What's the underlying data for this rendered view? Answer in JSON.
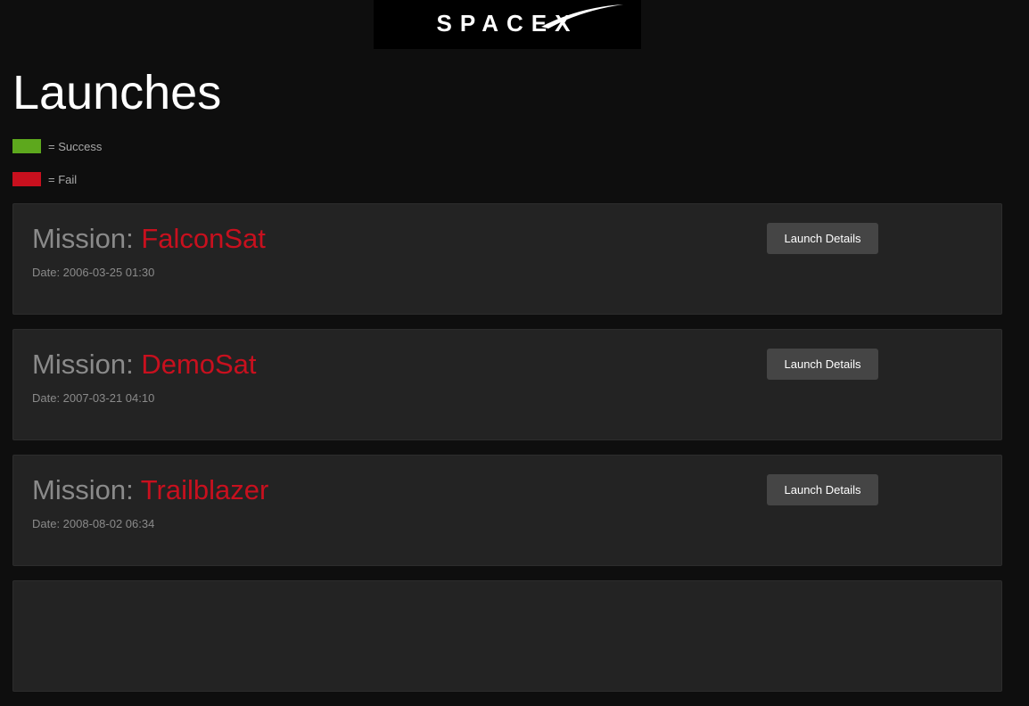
{
  "header": {
    "logo_text": "SPACEX"
  },
  "page": {
    "title": "Launches"
  },
  "legend": [
    {
      "label": "= Success",
      "color": "#5da81d"
    },
    {
      "label": "= Fail",
      "color": "#c8101e"
    }
  ],
  "launches": [
    {
      "prefix": "Mission: ",
      "name": "FalconSat",
      "date": "Date: 2006-03-25 01:30",
      "button_label": "Launch Details"
    },
    {
      "prefix": "Mission: ",
      "name": "DemoSat",
      "date": "Date: 2007-03-21 04:10",
      "button_label": "Launch Details"
    },
    {
      "prefix": "Mission: ",
      "name": "Trailblazer",
      "date": "Date: 2008-08-02 06:34",
      "button_label": "Launch Details"
    }
  ],
  "colors": {
    "background": "#0e0e0e",
    "card": "#232323",
    "fail": "#c8101e",
    "success": "#5da81d",
    "button": "#454545"
  }
}
